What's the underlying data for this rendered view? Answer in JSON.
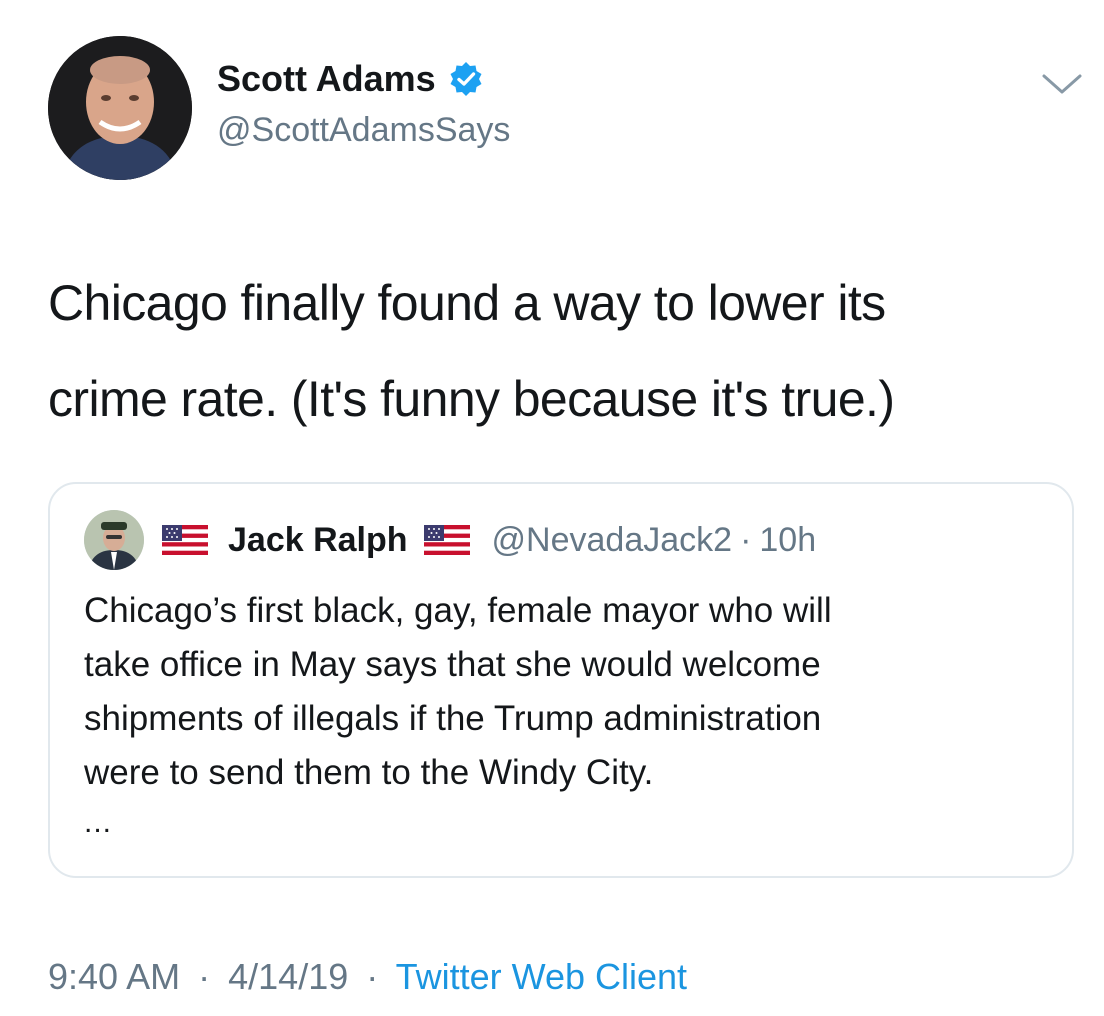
{
  "author": {
    "name": "Scott Adams",
    "handle": "@ScottAdamsSays",
    "verified": true,
    "icons": {
      "verified": "verified-badge-icon",
      "menu": "chevron-down-icon"
    },
    "colors": {
      "verified": "#1da1f2"
    }
  },
  "tweet": {
    "lines": [
      "Chicago finally found a way to lower its",
      "crime rate. (It's funny because it's true.)"
    ]
  },
  "quote": {
    "name": "Jack Ralph",
    "handle": "@NevadaJack2",
    "separator": "·",
    "time": "10h",
    "flag_icon": "us-flag-icon",
    "lines": [
      "Chicago’s first black, gay, female mayor who will",
      "take office in May says that she would welcome",
      "shipments of illegals if the Trump administration",
      "were to send them to the Windy City."
    ],
    "more": "..."
  },
  "footer": {
    "time": "9:40 AM",
    "separator": "·",
    "date": "4/14/19",
    "client": "Twitter Web Client",
    "colors": {
      "client": "#1b95e0",
      "meta": "#657786"
    }
  }
}
